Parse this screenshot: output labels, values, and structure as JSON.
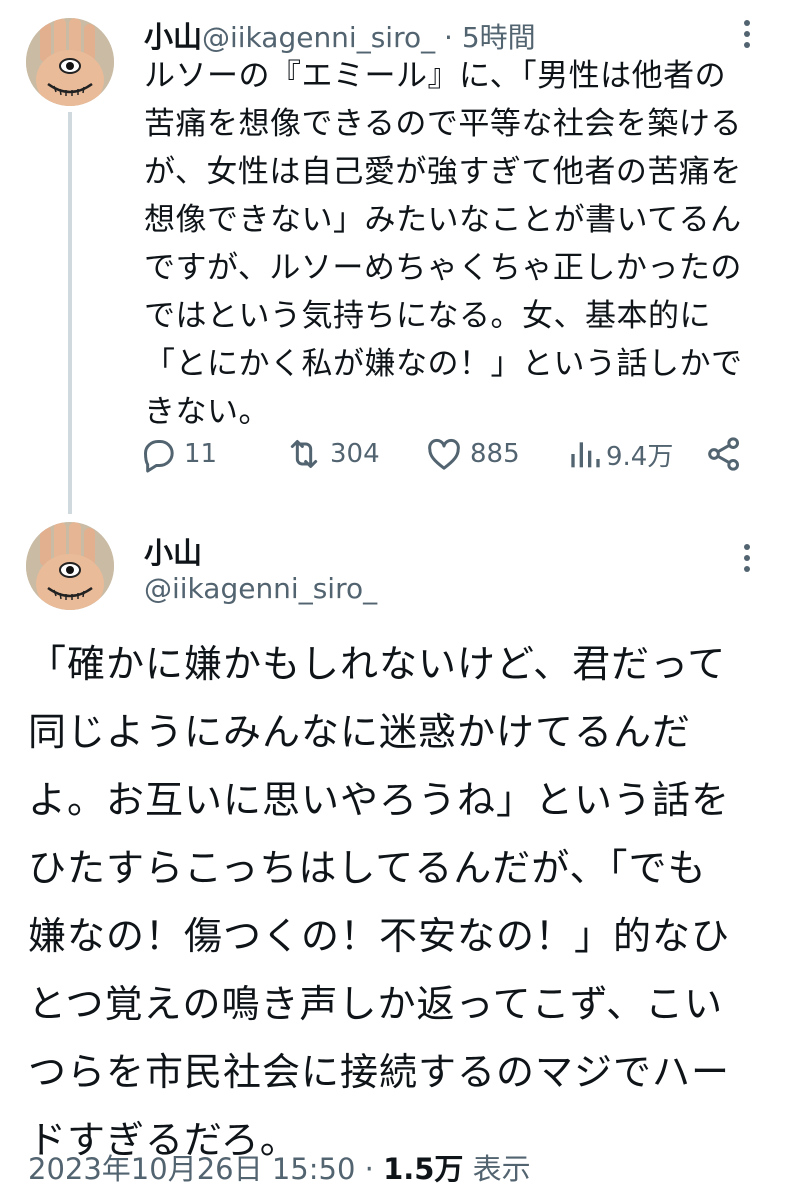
{
  "tweet1": {
    "author_name": "小山",
    "author_handle": "@iikagenni_siro_",
    "separator": "·",
    "time": "5時間",
    "text": "ルソーの『エミール』に、「男性は他者の\n苦痛を想像できるので平等な社会を築ける\nが、女性は自己愛が強すぎて他者の苦痛を\n想像できない」みたいなことが書いてるん\nですが、ルソーめちゃくちゃ正しかったの\nではという気持ちになる。女、基本的に\n「とにかく私が嫌なの！」という話しかで\nきない。",
    "replies": "11",
    "retweets": "304",
    "likes": "885",
    "views": "9.4万"
  },
  "tweet2": {
    "author_name": "小山",
    "author_handle": "@iikagenni_siro_",
    "text": "「確かに嫌かもしれないけど、君だって\n同じようにみんなに迷惑かけてるんだ\nよ。お互いに思いやろうね」という話を\nひたすらこっちはしてるんだが、「でも\n嫌なの！傷つくの！不安なの！」的なひ\nとつ覚えの鳴き声しか返ってこず、こい\nつらを市民社会に接続するのマジでハー\nドすぎるだろ。",
    "date": "2023年10月26日 15:50",
    "separator": "·",
    "views_count": "1.5万",
    "views_label": "表示"
  },
  "colors": {
    "text_primary": "#0f1419",
    "text_secondary": "#536471",
    "thread_line": "#cfd9de",
    "background": "#ffffff"
  },
  "icons": {
    "reply": "reply-icon",
    "retweet": "retweet-icon",
    "like": "heart-icon",
    "views": "views-icon",
    "share": "share-icon",
    "more": "more-icon"
  }
}
